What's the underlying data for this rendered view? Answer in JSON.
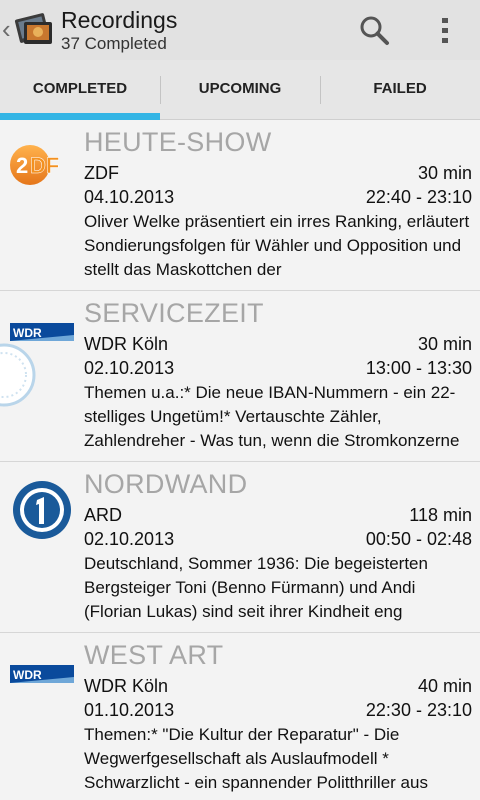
{
  "app_bar": {
    "title": "Recordings",
    "subtitle": "37 Completed",
    "icons": [
      "chevron-left-icon",
      "app-logo-icon",
      "search-icon",
      "overflow-menu-icon"
    ]
  },
  "tabs": [
    {
      "label": "COMPLETED",
      "selected": true
    },
    {
      "label": "UPCOMING",
      "selected": false
    },
    {
      "label": "FAILED",
      "selected": false
    }
  ],
  "colors": {
    "tab_indicator": "#33b5e5",
    "title_gray": "#a6a6a6",
    "zdf_orange": "#f39120",
    "wdr_blue": "#0a4a9c",
    "ard_blue": "#1a5a9a"
  },
  "recordings": [
    {
      "title": "HEUTE-SHOW",
      "channel": "ZDF",
      "channel_logo": "zdf-logo-icon",
      "duration": "30 min",
      "date": "04.10.2013",
      "time": "22:40 - 23:10",
      "description": "Oliver Welke präsentiert ein irres Ranking, erläutert Sondierungsfolgen für Wähler und Opposition und stellt das Maskottchen der"
    },
    {
      "title": "SERVICEZEIT",
      "channel": "WDR Köln",
      "channel_logo": "wdr-logo-icon",
      "duration": "30 min",
      "date": "02.10.2013",
      "time": "13:00 - 13:30",
      "description": "Themen u.a.:* Die neue IBAN-Nummern - ein 22-stelliges Ungetüm!* Vertauschte Zähler, Zahlendreher - Was tun, wenn die Stromkonzerne"
    },
    {
      "title": "NORDWAND",
      "channel": "ARD",
      "channel_logo": "ard-logo-icon",
      "duration": "118 min",
      "date": "02.10.2013",
      "time": "00:50 - 02:48",
      "description": "Deutschland, Sommer 1936: Die begeisterten Bergsteiger Toni (Benno Fürmann) und Andi (Florian Lukas) sind seit ihrer Kindheit eng"
    },
    {
      "title": "WEST ART",
      "channel": "WDR Köln",
      "channel_logo": "wdr-logo-icon",
      "duration": "40 min",
      "date": "01.10.2013",
      "time": "22:30 - 23:10",
      "description": "Themen:* \"Die Kultur der Reparatur\" - Die Wegwerfgesellschaft als Auslaufmodell * Schwarzlicht - ein spannender Politthriller aus"
    }
  ]
}
